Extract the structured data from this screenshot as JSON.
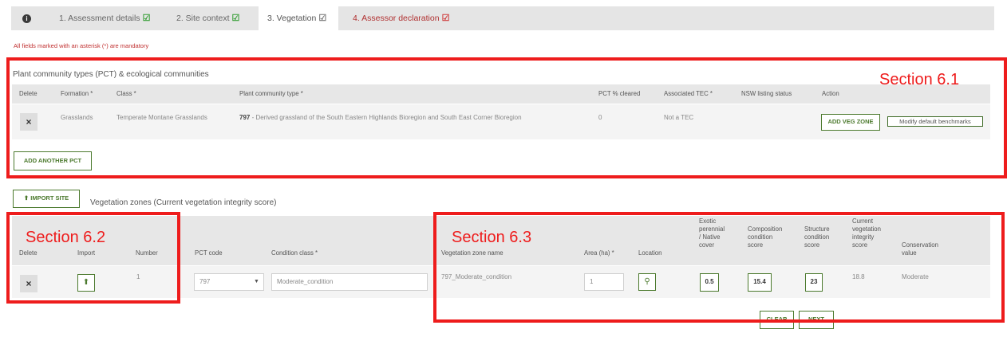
{
  "tabs": [
    {
      "icon": "info-icon",
      "label": "❶"
    },
    {
      "label": "1. Assessment details",
      "status": "complete"
    },
    {
      "label": "2. Site context",
      "status": "complete"
    },
    {
      "label": "3. Vegetation",
      "status": "active"
    },
    {
      "label": "4. Assessor declaration",
      "status": "incomplete"
    }
  ],
  "check_glyph": "☑",
  "mandatory_note": "All fields marked with an asterisk (*) are mandatory",
  "annotations": {
    "section_6_1": "Section 6.1",
    "section_6_2": "Section 6.2",
    "section_6_3": "Section 6.3"
  },
  "pct_section": {
    "title": "Plant community types (PCT) & ecological communities",
    "headers": {
      "delete": "Delete",
      "formation": "Formation *",
      "class": "Class *",
      "pct": "Plant community type *",
      "cleared": "PCT % cleared",
      "tec": "Associated TEC *",
      "nsw": "NSW listing status",
      "action": "Action"
    },
    "row": {
      "delete": "×",
      "formation": "Grasslands",
      "class": "Temperate Montane Grasslands",
      "pct_code": "797",
      "pct_name": " - Derived grassland of the South Eastern Highlands Bioregion and South East Corner Bioregion",
      "cleared": "0",
      "tec": "Not a TEC",
      "add_veg_zone": "ADD VEG ZONE",
      "modify_benchmarks": "Modify default benchmarks"
    },
    "add_another_pct": "ADD ANOTHER PCT"
  },
  "veg_zones": {
    "import_site_label": "IMPORT SITE",
    "title": "Vegetation zones (Current vegetation integrity score)",
    "headers": {
      "delete": "Delete",
      "import": "Import",
      "number": "Number",
      "pct_code": "PCT code",
      "condition_class": "Condition class *",
      "zone_name": "Vegetation zone name",
      "area": "Area (ha) *",
      "location": "Location",
      "exotic_1": "Exotic",
      "exotic_2": "perennial",
      "exotic_3": "/ Native",
      "exotic_4": "cover",
      "comp_1": "Composition",
      "comp_2": "condition",
      "comp_3": "score",
      "struct_1": "Structure",
      "struct_2": "condition",
      "struct_3": "score",
      "cvis_1": "Current",
      "cvis_2": "vegetation",
      "cvis_3": "integrity",
      "cvis_4": "score",
      "cons_1": "Conservation",
      "cons_2": "value"
    },
    "row": {
      "delete": "×",
      "number": "1",
      "pct_code": "797",
      "condition_class": "Moderate_condition",
      "zone_name": "797_Moderate_condition",
      "area": "1",
      "exotic_cover": "0.5",
      "composition_score": "15.4",
      "structure_score": "23",
      "cvis": "18.8",
      "conservation_value": "Moderate"
    },
    "clear_label": "CLEAR",
    "next_label": "NEXT"
  }
}
